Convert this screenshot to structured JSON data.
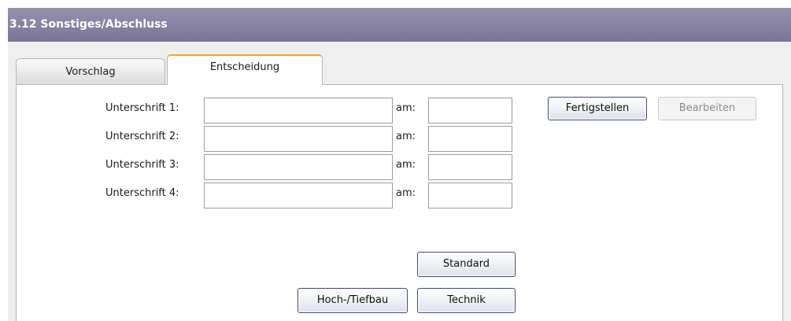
{
  "window": {
    "title": "3.12 Sonstiges/Abschluss"
  },
  "tabs": [
    {
      "label": "Vorschlag",
      "active": false
    },
    {
      "label": "Entscheidung",
      "active": true
    }
  ],
  "signatures": [
    {
      "label": "Unterschrift 1:",
      "value": "",
      "date_label": "am:",
      "date_value": ""
    },
    {
      "label": "Unterschrift 2:",
      "value": "",
      "date_label": "am:",
      "date_value": ""
    },
    {
      "label": "Unterschrift 3:",
      "value": "",
      "date_label": "am:",
      "date_value": ""
    },
    {
      "label": "Unterschrift 4:",
      "value": "",
      "date_label": "am:",
      "date_value": ""
    }
  ],
  "actions": {
    "finish_label": "Fertigstellen",
    "edit_label": "Bearbeiten",
    "edit_enabled": false
  },
  "templates": {
    "standard_label": "Standard",
    "hochtiefbau_label": "Hoch-/Tiefbau",
    "technik_label": "Technik"
  },
  "colors": {
    "titlebar": "#8a86a3",
    "active_tab_accent": "#f0a732",
    "button_border": "#3e4a7a"
  }
}
